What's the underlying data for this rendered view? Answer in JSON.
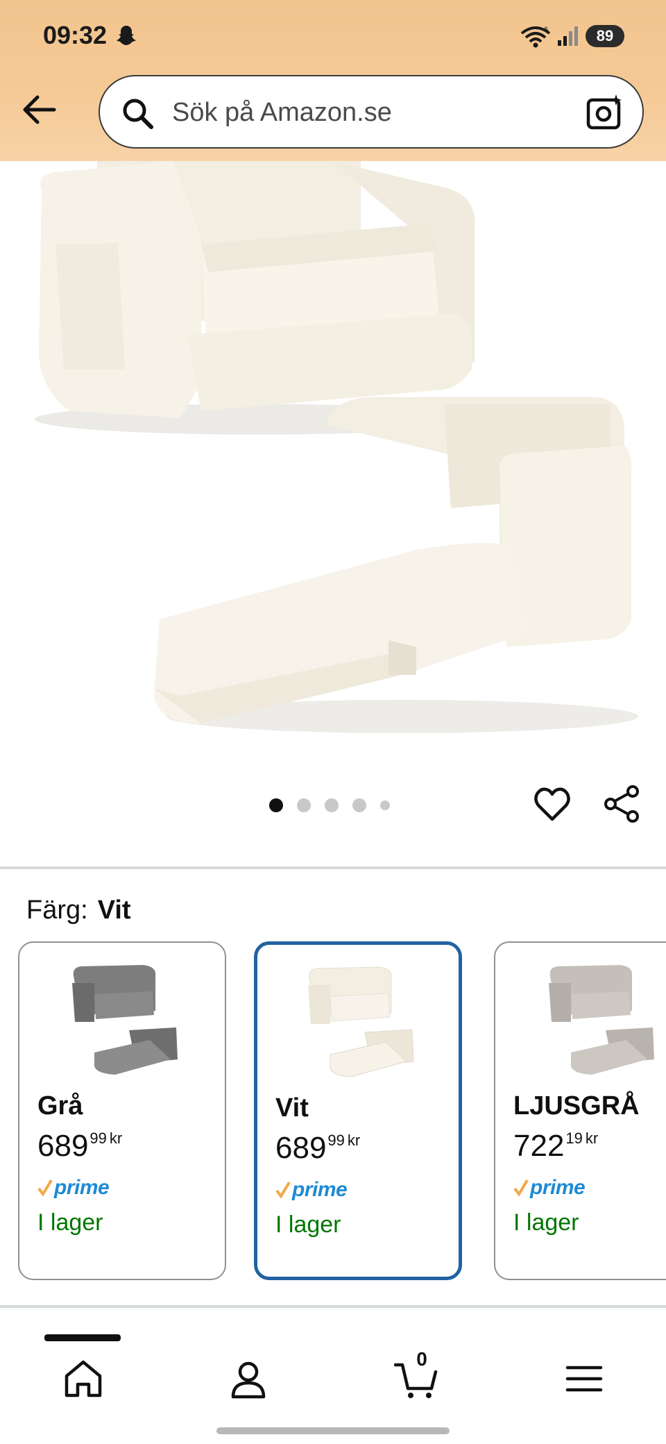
{
  "status_bar": {
    "time": "09:32",
    "battery": "89"
  },
  "search": {
    "placeholder": "Sök på Amazon.se"
  },
  "gallery": {
    "image_count": 5,
    "active_index": 0
  },
  "color_selector": {
    "label": "Färg:",
    "selected": "Vit",
    "options": [
      {
        "name": "Grå",
        "price_whole": "689",
        "price_fraction": "99",
        "currency": "kr",
        "prime": "prime",
        "availability": "I lager",
        "selected": false,
        "color": "#7a7a7a"
      },
      {
        "name": "Vit",
        "price_whole": "689",
        "price_fraction": "99",
        "currency": "kr",
        "prime": "prime",
        "availability": "I lager",
        "selected": true,
        "color": "#f4efe2"
      },
      {
        "name": "LJUSGRÅ",
        "price_whole": "722",
        "price_fraction": "19",
        "currency": "kr",
        "prime": "prime",
        "availability": "I lager",
        "selected": false,
        "color": "#bdb8b2"
      }
    ]
  },
  "bottom_nav": {
    "cart_count": "0",
    "items": [
      "home",
      "account",
      "cart",
      "menu"
    ]
  },
  "colors": {
    "header": "#f5c995",
    "selected_border": "#2162a1",
    "in_stock": "#007600",
    "prime_blue": "#1f8ad4",
    "prime_check": "#f3a847"
  }
}
